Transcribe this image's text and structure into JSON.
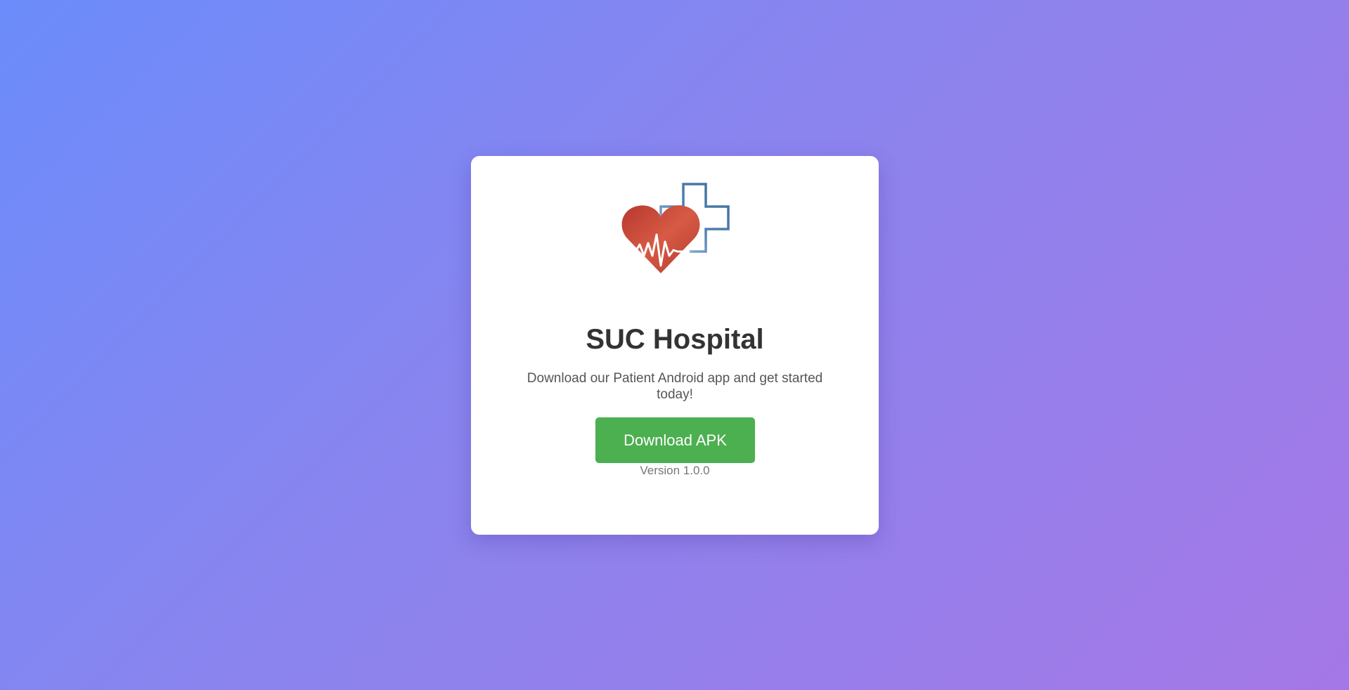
{
  "app": {
    "name": "SUC Hospital",
    "logo_icon": "heart-pulse-medical-cross-icon"
  },
  "main": {
    "title": "SUC Hospital",
    "subtitle": "Download our Patient Android app and get started today!",
    "download_label": "Download APK",
    "version": "Version 1.0.0"
  },
  "colors": {
    "background_start": "#6b8cfb",
    "background_end": "#a478e6",
    "card": "#ffffff",
    "button": "#4caf50",
    "heart": "#c94a3a",
    "cross": "#4a78a8",
    "title": "#333333"
  }
}
